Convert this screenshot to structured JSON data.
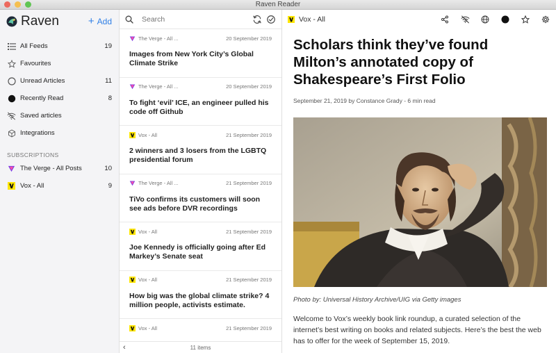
{
  "window": {
    "title": "Raven Reader",
    "lights": {
      "close": "#ed6a5e",
      "minimize": "#f5bf4f",
      "zoom": "#61c554"
    }
  },
  "sidebar": {
    "brand": "Raven",
    "add_label": "Add",
    "accent": "#2f7fe6",
    "nav": [
      {
        "label": "All Feeds",
        "count": "19",
        "icon": "list-icon"
      },
      {
        "label": "Favourites",
        "count": "",
        "icon": "star-icon"
      },
      {
        "label": "Unread Articles",
        "count": "11",
        "icon": "circle-outline-icon"
      },
      {
        "label": "Recently Read",
        "count": "8",
        "icon": "filled-circle-icon"
      },
      {
        "label": "Saved articles",
        "count": "",
        "icon": "wifi-off-icon"
      },
      {
        "label": "Integrations",
        "count": "",
        "icon": "cube-icon"
      }
    ],
    "subscriptions_heading": "SUBSCRIPTIONS",
    "subscriptions": [
      {
        "label": "The Verge - All Posts",
        "count": "10",
        "icon": "verge-logo-icon"
      },
      {
        "label": "Vox - All",
        "count": "9",
        "icon": "vox-logo-icon"
      }
    ]
  },
  "list": {
    "search_placeholder": "Search",
    "footer": "11 items",
    "items": [
      {
        "source": "The Verge - All ...",
        "date": "20 September 2019",
        "title": "Images from New York City’s Global Climate Strike",
        "icon": "verge-logo-icon"
      },
      {
        "source": "The Verge - All ...",
        "date": "20 September 2019",
        "title": "To fight ‘evil’ ICE, an engineer pulled his code off Github",
        "icon": "verge-logo-icon"
      },
      {
        "source": "Vox - All",
        "date": "21 September 2019",
        "title": "2 winners and 3 losers from the LGBTQ presidential forum",
        "icon": "vox-logo-icon"
      },
      {
        "source": "The Verge - All ...",
        "date": "21 September 2019",
        "title": "TiVo confirms its customers will soon see ads before DVR recordings",
        "icon": "verge-logo-icon"
      },
      {
        "source": "Vox - All",
        "date": "21 September 2019",
        "title": "Joe Kennedy is officially going after Ed Markey’s Senate seat",
        "icon": "vox-logo-icon"
      },
      {
        "source": "Vox - All",
        "date": "21 September 2019",
        "title": "How big was the global climate strike? 4 million people, activists estimate.",
        "icon": "vox-logo-icon"
      },
      {
        "source": "Vox - All",
        "date": "21 September 2019",
        "title": "",
        "icon": "vox-logo-icon"
      }
    ]
  },
  "reader": {
    "feed_name": "Vox - All",
    "toolbar_icons": [
      "share-icon",
      "wifi-off-icon",
      "globe-icon",
      "filled-circle-icon",
      "star-icon",
      "gear-icon"
    ],
    "title": "Scholars think they’ve found Milton’s annotated copy of Shakespeare’s First Folio",
    "byline": "September 21, 2019 by Constance Grady - 6 min read",
    "caption": "Photo by: Universal History Archive/UIG via Getty images",
    "body": "Welcome to Vox’s weekly book link roundup, a curated selection of the internet’s best writing on books and related subjects. Here’s the best the web has to offer for the week of September 15, 2019."
  }
}
